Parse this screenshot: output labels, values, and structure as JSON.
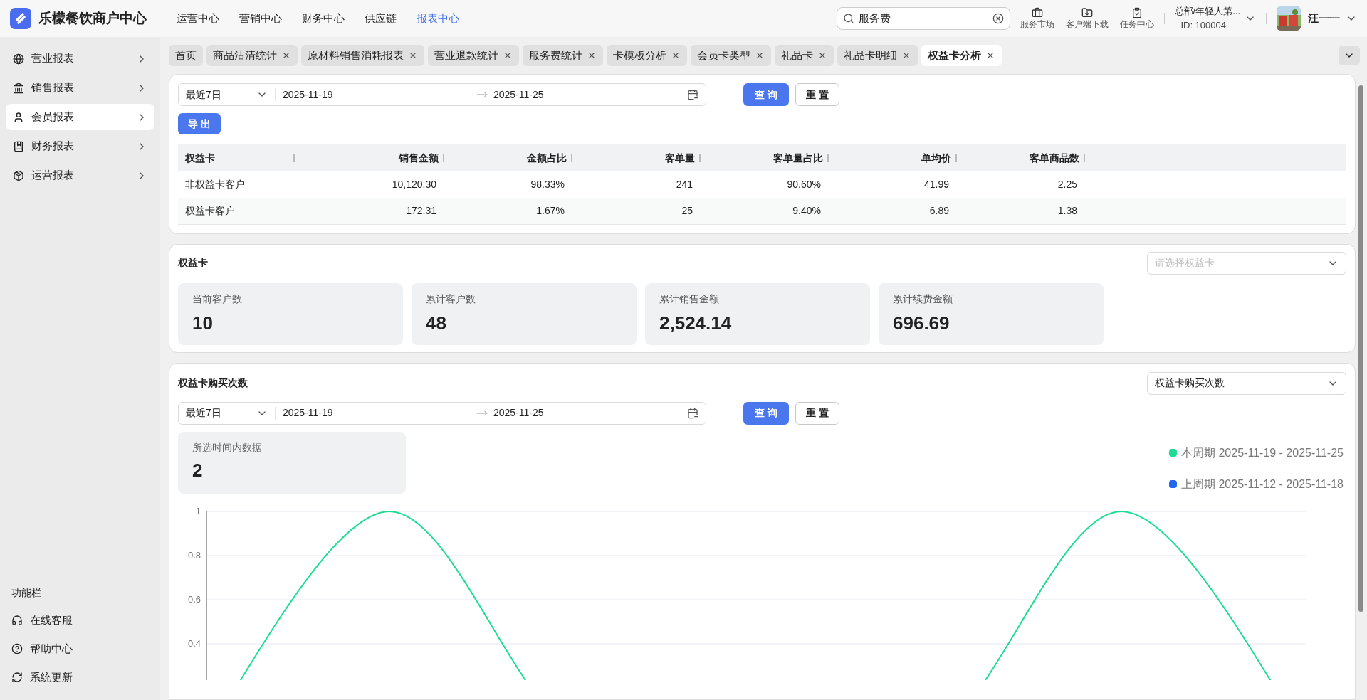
{
  "header": {
    "brand": "乐檬餐饮商户中心",
    "nav": [
      {
        "label": "运营中心",
        "selected": false
      },
      {
        "label": "营销中心",
        "selected": false
      },
      {
        "label": "财务中心",
        "selected": false
      },
      {
        "label": "供应链",
        "selected": false
      },
      {
        "label": "报表中心",
        "selected": true
      }
    ],
    "search": {
      "value": "服务费"
    },
    "tools": [
      {
        "kind": "bag",
        "label": "服务市场"
      },
      {
        "kind": "download",
        "label": "客户端下载"
      },
      {
        "kind": "task",
        "label": "任务中心"
      }
    ],
    "org": {
      "name": "总部/年轻人第...",
      "id": "ID: 100004"
    },
    "user": {
      "name": "汪一一"
    }
  },
  "sidebar": {
    "items": [
      {
        "kind": "globe",
        "label": "营业报表",
        "selected": false
      },
      {
        "kind": "bank",
        "label": "销售报表",
        "selected": false
      },
      {
        "kind": "user",
        "label": "会员报表",
        "selected": true
      },
      {
        "kind": "ledger",
        "label": "财务报表",
        "selected": false
      },
      {
        "kind": "box",
        "label": "运营报表",
        "selected": false
      }
    ],
    "footer_title": "功能栏",
    "footer_items": [
      {
        "kind": "headset",
        "label": "在线客服"
      },
      {
        "kind": "help",
        "label": "帮助中心"
      },
      {
        "kind": "refresh",
        "label": "系统更新"
      }
    ]
  },
  "tabs": [
    {
      "label": "首页",
      "closable": false,
      "selected": false
    },
    {
      "label": "商品沽清统计",
      "closable": true,
      "selected": false
    },
    {
      "label": "原材料销售消耗报表",
      "closable": true,
      "selected": false
    },
    {
      "label": "营业退款统计",
      "closable": true,
      "selected": false
    },
    {
      "label": "服务费统计",
      "closable": true,
      "selected": false
    },
    {
      "label": "卡模板分析",
      "closable": true,
      "selected": false
    },
    {
      "label": "会员卡类型",
      "closable": true,
      "selected": false
    },
    {
      "label": "礼品卡",
      "closable": true,
      "selected": false
    },
    {
      "label": "礼品卡明细",
      "closable": true,
      "selected": false
    },
    {
      "label": "权益卡分析",
      "closable": true,
      "selected": true
    }
  ],
  "summary": {
    "filter": {
      "preset": "最近7日",
      "start": "2025-11-19",
      "end": "2025-11-25",
      "query": "查 询",
      "reset": "重 置"
    },
    "export": "导 出",
    "table": {
      "columns": [
        "权益卡",
        "销售金额",
        "金额占比",
        "客单量",
        "客单量占比",
        "单均价",
        "客单商品数"
      ],
      "rows": [
        [
          "非权益卡客户",
          "10,120.30",
          "98.33%",
          "241",
          "90.60%",
          "41.99",
          "2.25"
        ],
        [
          "权益卡客户",
          "172.31",
          "1.67%",
          "25",
          "9.40%",
          "6.89",
          "1.38"
        ]
      ]
    }
  },
  "cards": {
    "title": "权益卡",
    "select": {
      "placeholder": "请选择权益卡"
    },
    "stats": [
      {
        "label": "当前客户数",
        "value": "10"
      },
      {
        "label": "累计客户数",
        "value": "48"
      },
      {
        "label": "累计销售金额",
        "value": "2,524.14"
      },
      {
        "label": "累计续费金额",
        "value": "696.69"
      }
    ]
  },
  "purchases": {
    "title": "权益卡购买次数",
    "select": {
      "value": "权益卡购买次数"
    },
    "filter": {
      "preset": "最近7日",
      "start": "2025-11-19",
      "end": "2025-11-25",
      "query": "查 询",
      "reset": "重 置"
    },
    "stat": {
      "label": "所选时间内数据",
      "value": "2"
    },
    "chart": {
      "y_labels": [
        "1",
        "0.8",
        "0.6",
        "0.4"
      ],
      "legend": [
        {
          "label": "本周期 2025-11-19 - 2025-11-25",
          "color": "#1edc94"
        },
        {
          "label": "上周期 2025-11-12 - 2025-11-18",
          "color": "#2266ee"
        }
      ]
    }
  }
}
